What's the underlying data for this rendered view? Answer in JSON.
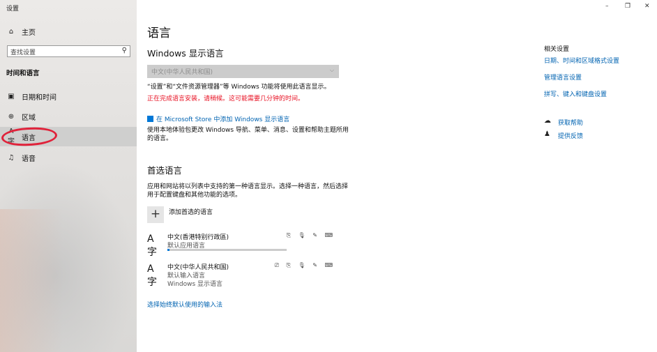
{
  "window": {
    "title": "设置",
    "minimize": "–",
    "maximize": "❐",
    "close": "✕"
  },
  "sidebar": {
    "home_label": "主页",
    "search_placeholder": "查找设置",
    "section": "时间和语言",
    "items": [
      {
        "label": "日期和时间",
        "icon": "calendar-icon"
      },
      {
        "label": "区域",
        "icon": "globe-icon"
      },
      {
        "label": "语言",
        "icon": "language-icon"
      },
      {
        "label": "语音",
        "icon": "microphone-icon"
      }
    ]
  },
  "main": {
    "title": "语言",
    "display_heading": "Windows 显示语言",
    "display_dropdown_value": "中文(中华人民共和国)",
    "display_note": "“设置”和“文件资源管理器”等 Windows 功能将使用此语言显示。",
    "install_warning": "正在完成语言安装，请稍候。这可能需要几分钟的时间。",
    "store_link": "在 Microsoft Store 中添加 Windows 显示语言",
    "store_desc_1": "使用本地体验包更改 Windows 导航、菜单、消息、设置和帮助主题所用",
    "store_desc_2": "的语言。",
    "preferred_heading": "首选语言",
    "preferred_desc_1": "应用和网站将以列表中支持的第一种语言显示。选择一种语言，然后选择",
    "preferred_desc_2": "用于配置键盘和其他功能的选项。",
    "add_label": "添加首选的语言",
    "languages": [
      {
        "name": "中文(香港特别行政區)",
        "sub1": "默认应用语言",
        "sub2": "",
        "features": "⎘ 🎙 ✎ ⌨",
        "progress": 0.02
      },
      {
        "name": "中文(中华人民共和国)",
        "sub1": "默认输入语言",
        "sub2": "Windows 显示语言",
        "features": "⎚ ⎘ 🎙 ✎ ⌨"
      }
    ],
    "ime_link": "选择始终默认使用的输入法"
  },
  "related": {
    "title": "相关设置",
    "links": [
      "日期、时间和区域格式设置",
      "管理语言设置",
      "拼写、键入和键盘设置"
    ],
    "help": "获取帮助",
    "feedback": "提供反馈"
  }
}
